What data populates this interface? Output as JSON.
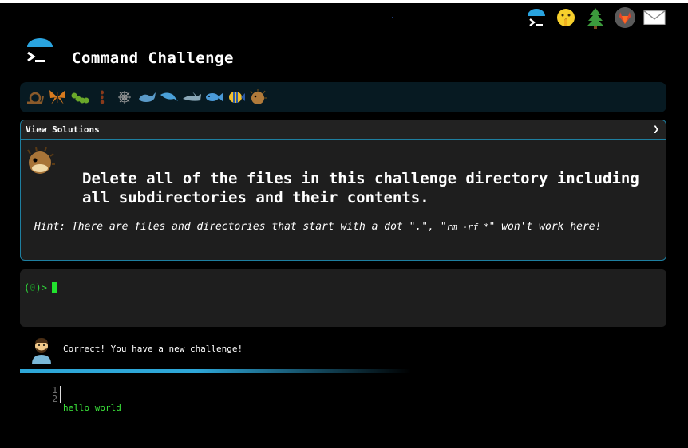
{
  "app": {
    "title": "Command Challenge"
  },
  "top_icons": [
    {
      "name": "brand-icon"
    },
    {
      "name": "shushing-face-icon"
    },
    {
      "name": "tree-icon"
    },
    {
      "name": "gitlab-icon"
    },
    {
      "name": "mail-icon"
    }
  ],
  "levels": [
    {
      "name": "snail-icon",
      "glyph": "🐌"
    },
    {
      "name": "butterfly-icon",
      "glyph": "🦋"
    },
    {
      "name": "caterpillar-icon",
      "glyph": "🐛"
    },
    {
      "name": "ant-icon",
      "glyph": "🐜"
    },
    {
      "name": "spider-web-icon",
      "glyph": "🕸"
    },
    {
      "name": "whale-icon",
      "glyph": "🐋"
    },
    {
      "name": "dolphin-icon",
      "glyph": "🐬"
    },
    {
      "name": "shark-icon",
      "glyph": "🦈"
    },
    {
      "name": "fish-icon",
      "glyph": "🐟"
    },
    {
      "name": "tropical-fish-icon",
      "glyph": "🐠"
    },
    {
      "name": "blowfish-icon",
      "glyph": "🐡"
    }
  ],
  "card": {
    "header_label": "View Solutions",
    "chevron": "❯",
    "challenge": "Delete all of the files in this challenge directory including all subdirectories and their contents.",
    "hint_prefix": "Hint: There are files and directories that start with a dot \".\", \"",
    "hint_code": "rm -rf *",
    "hint_suffix": "\" won't work here!"
  },
  "terminal": {
    "prompt_open": "(",
    "prompt_count": "0",
    "prompt_close": ")>"
  },
  "message": {
    "text": "Correct! You have a new challenge!"
  },
  "editor": {
    "line_numbers": [
      "1",
      "2"
    ],
    "lines": [
      "hello world",
      ""
    ]
  },
  "colors": {
    "accent": "#2ea7d8",
    "card_border": "#1e7fa0",
    "terminal_green": "#2fd83a",
    "panel_bg": "#1e1e1e"
  }
}
